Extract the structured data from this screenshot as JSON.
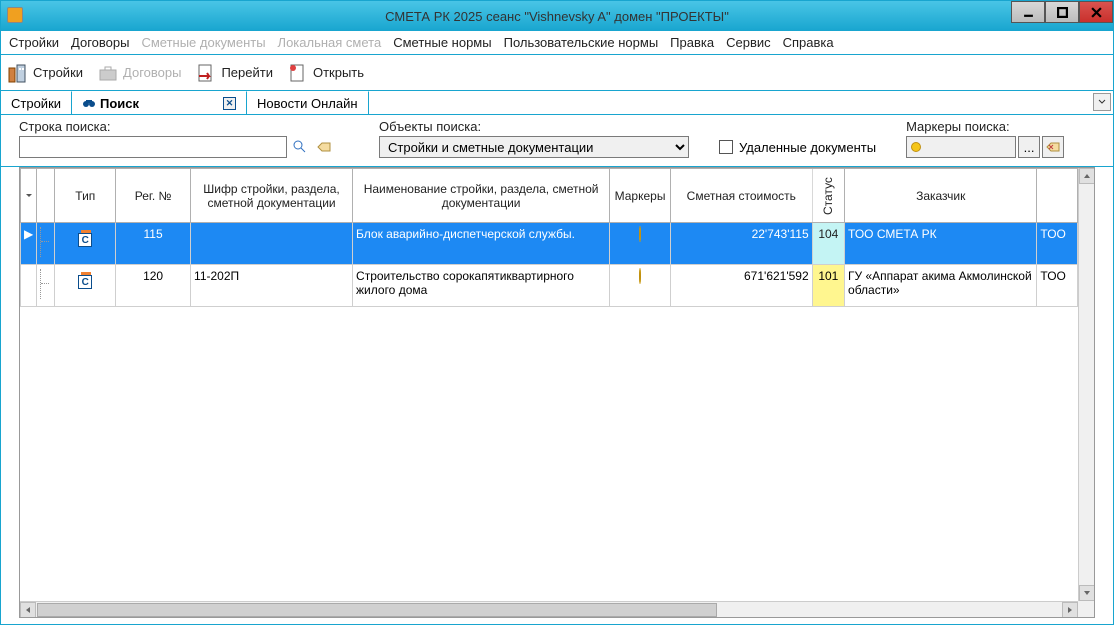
{
  "window": {
    "title": "СМЕТА РК 2025    сеанс \"Vishnevsky A\"  домен \"ПРОЕКТЫ\""
  },
  "menu": [
    "Стройки",
    "Договоры",
    "Сметные документы",
    "Локальная смета",
    "Сметные нормы",
    "Пользовательские нормы",
    "Правка",
    "Сервис",
    "Справка"
  ],
  "menu_disabled": [
    2,
    3
  ],
  "toolbar": [
    {
      "label": "Стройки",
      "icon": "buildings",
      "disabled": false
    },
    {
      "label": "Договоры",
      "icon": "briefcase",
      "disabled": true
    },
    {
      "label": "Перейти",
      "icon": "goto",
      "disabled": false
    },
    {
      "label": "Открыть",
      "icon": "open",
      "disabled": false
    }
  ],
  "tabs": [
    {
      "label": "Стройки",
      "active": false,
      "closable": false
    },
    {
      "label": "Поиск",
      "active": true,
      "closable": true,
      "icon": "search-binocular"
    },
    {
      "label": "Новости Онлайн",
      "active": false,
      "closable": false
    }
  ],
  "search": {
    "string_label": "Строка поиска:",
    "objects_label": "Объекты поиска:",
    "objects_selected": "Стройки и сметные документации",
    "deleted_label": "Удаленные документы",
    "markers_label": "Маркеры поиска:",
    "marker_dots": "..."
  },
  "grid": {
    "headers": {
      "type": "Тип",
      "reg": "Рег. №",
      "code": "Шифр стройки, раздела, сметной документации",
      "name": "Наименование стройки, раздела, сметной документации",
      "markers": "Маркеры",
      "cost": "Сметная стоимость",
      "status": "Статус",
      "customer": "Заказчик"
    },
    "rows": [
      {
        "selected": true,
        "type": "С",
        "reg": "115",
        "code": "",
        "name": "Блок аварийно-диспетчерской службы.",
        "marker": "yellow",
        "cost": "22'743'115",
        "status": "104",
        "customer": "ТОО СМЕТА РК",
        "extra": "ТОО"
      },
      {
        "selected": false,
        "type": "С",
        "reg": "120",
        "code": "11-202П",
        "name": "Строительство сорокапятиквартирного жилого дома",
        "marker": "yellow",
        "cost": "671'621'592",
        "status": "101",
        "customer": "ГУ «Аппарат акима Акмолинской области»",
        "extra": "ТОО"
      }
    ]
  }
}
